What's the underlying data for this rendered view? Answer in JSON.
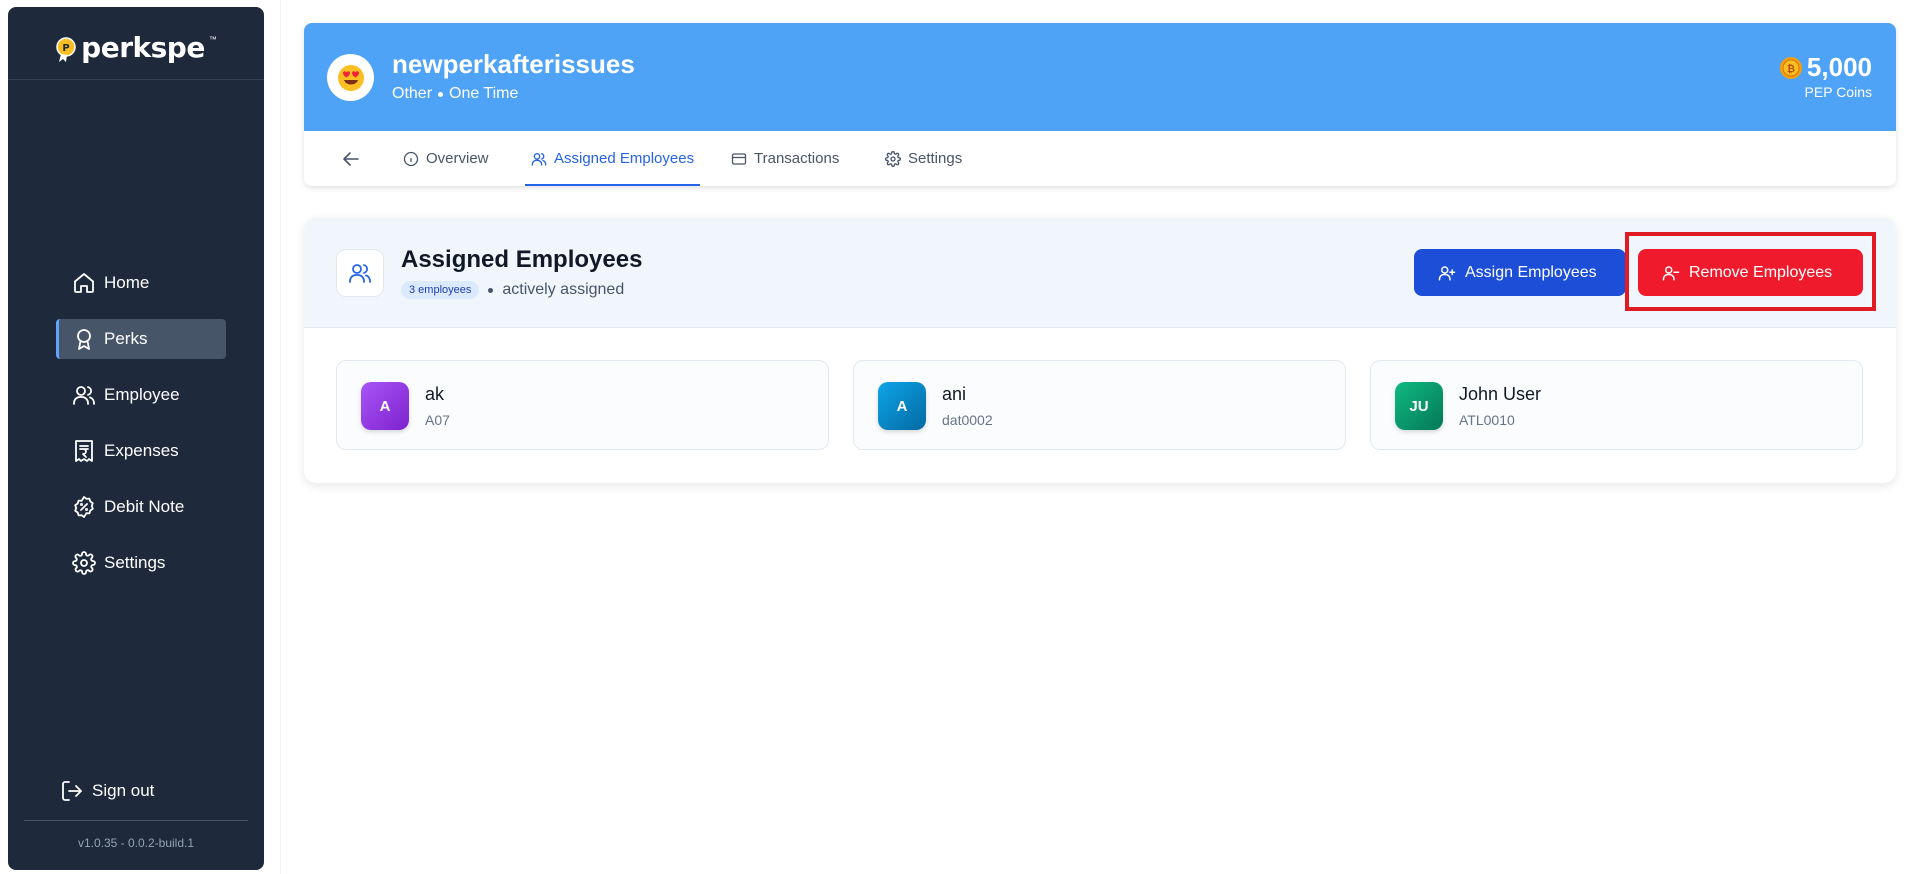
{
  "brand": {
    "logo_text": "perkspe",
    "logo_tm": "™",
    "version": "v1.0.35 - 0.0.2-build.1"
  },
  "sidebar": {
    "items": [
      {
        "label": "Home",
        "icon": "home-icon",
        "active": false
      },
      {
        "label": "Perks",
        "icon": "award-icon",
        "active": true
      },
      {
        "label": "Employee",
        "icon": "users-icon",
        "active": false
      },
      {
        "label": "Expenses",
        "icon": "receipt-icon",
        "active": false
      },
      {
        "label": "Debit Note",
        "icon": "badge-percent-icon",
        "active": false
      },
      {
        "label": "Settings",
        "icon": "gear-icon",
        "active": false
      }
    ],
    "signout_label": "Sign out"
  },
  "perk": {
    "title": "newperkafterissues",
    "category": "Other",
    "frequency": "One Time",
    "coins_value": "5,000",
    "coins_label": "PEP Coins",
    "avatar_icon": "heart-eyes-emoji-icon"
  },
  "tabs": [
    {
      "label": "Overview",
      "icon": "info-icon"
    },
    {
      "label": "Assigned Employees",
      "icon": "users-icon",
      "active": true
    },
    {
      "label": "Transactions",
      "icon": "credit-card-icon"
    },
    {
      "label": "Settings",
      "icon": "gear-icon"
    }
  ],
  "section": {
    "title": "Assigned Employees",
    "count_badge": "3 employees",
    "status_text": "actively assigned",
    "assign_label": "Assign Employees",
    "remove_label": "Remove Employees"
  },
  "employees": [
    {
      "initials": "A",
      "name": "ak",
      "id": "A07",
      "color": "#9333ea"
    },
    {
      "initials": "A",
      "name": "ani",
      "id": "dat0002",
      "color": "#0284c7"
    },
    {
      "initials": "JU",
      "name": "John User",
      "id": "ATL0010",
      "color": "#059669"
    }
  ],
  "colors": {
    "sidebar_bg": "#1e293b",
    "banner_bg": "#4fa3f7",
    "accent_blue": "#2563eb",
    "danger_red": "#ef1b2d"
  }
}
